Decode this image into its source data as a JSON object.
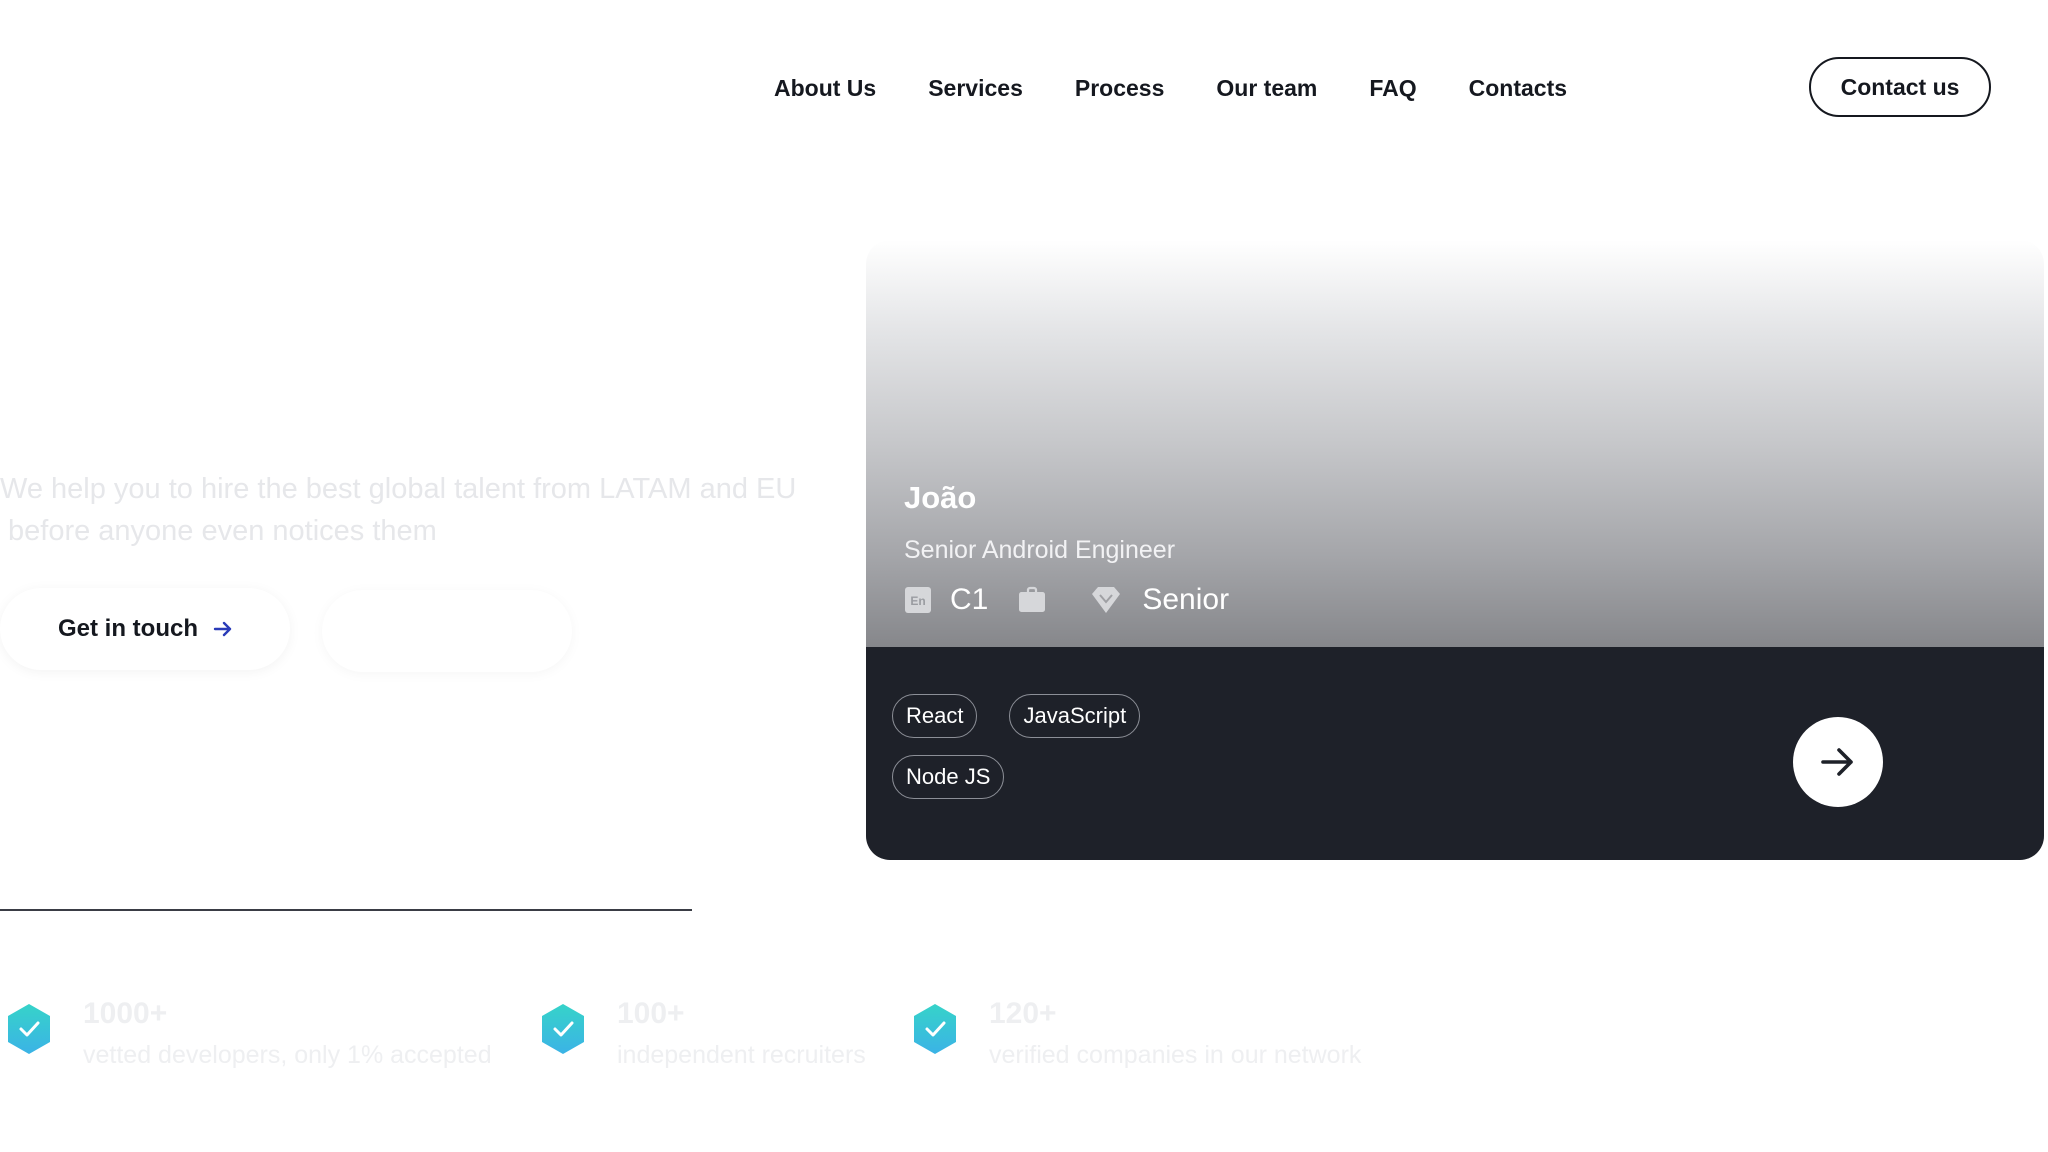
{
  "nav": {
    "links": [
      "About Us",
      "Services",
      "Process",
      "Our team",
      "FAQ",
      "Contacts"
    ],
    "cta_label": "Contact us"
  },
  "hero": {
    "tagline_line1": "We help you to hire the best global talent from LATAM and EU",
    "tagline_line2": "before anyone even notices them",
    "primary_cta": "Get in touch"
  },
  "candidate": {
    "name": "João",
    "role": "Senior Android Engineer",
    "language_icon_text": "En",
    "language_level": "C1",
    "seniority": "Senior",
    "skills_row1": [
      "React",
      "JavaScript"
    ],
    "skills_row2": [
      "Node JS"
    ]
  },
  "stats": [
    {
      "value": "1000+",
      "label": "vetted developers, only 1% accepted"
    },
    {
      "value": "100+",
      "label": "independent recruiters"
    },
    {
      "value": "120+",
      "label": "verified companies in our network"
    }
  ],
  "colors": {
    "text_dark": "#15181f",
    "card_dark": "#1e2129",
    "accent_arrow": "#2a3bb8",
    "badge_teal_top": "#36d3c9",
    "badge_teal_bottom": "#3bb3e6"
  }
}
